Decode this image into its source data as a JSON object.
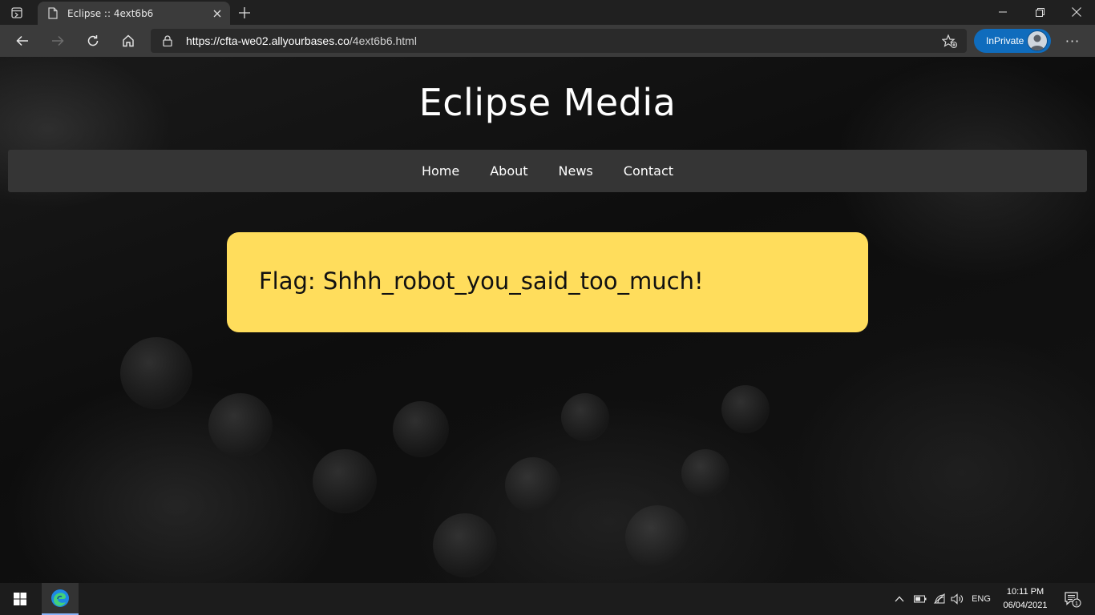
{
  "browser": {
    "tab_title": "Eclipse :: 4ext6b6",
    "url_host": "https://cfta-we02.allyourbases.co",
    "url_path": "/4ext6b6.html",
    "inprivate_label": "InPrivate",
    "menu_label": "···"
  },
  "site": {
    "title": "Eclipse Media",
    "nav": [
      "Home",
      "About",
      "News",
      "Contact"
    ],
    "flag_text": "Flag: Shhh_robot_you_said_too_much!"
  },
  "taskbar": {
    "language": "ENG",
    "time": "10:11 PM",
    "date": "06/04/2021",
    "notification_count": "1"
  },
  "colors": {
    "flag_card": "#ffdd5c",
    "navbar": "#353535",
    "inprivate": "#0f6cbd"
  }
}
